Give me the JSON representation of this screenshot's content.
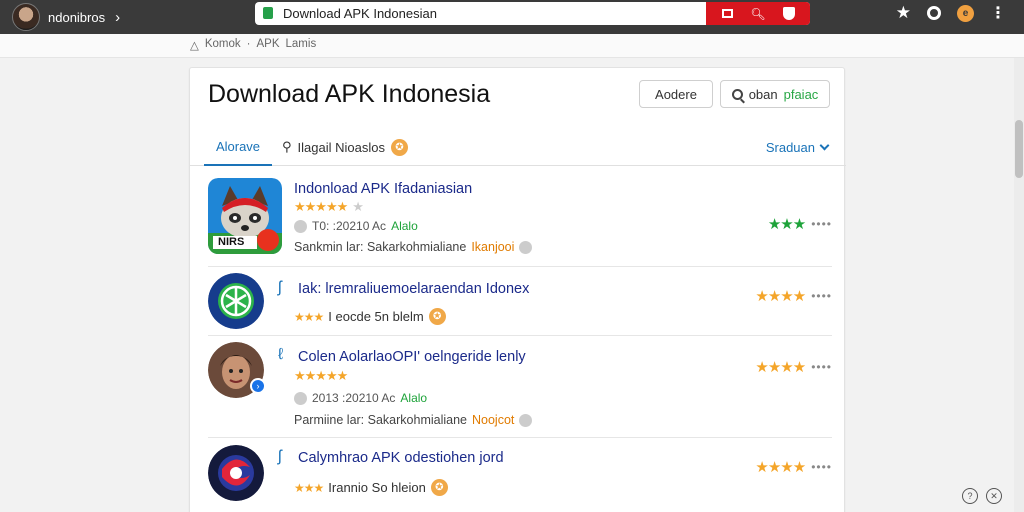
{
  "browser": {
    "profile_name": "ndonibros",
    "url": "Download APK Indonesian"
  },
  "breadcrumb": {
    "items": [
      "Komok",
      "APK",
      "Lamis"
    ],
    "separator": "·"
  },
  "header": {
    "title": "Download APK Indonesia",
    "button_1": "Aodere",
    "button_2_prefix": "oban",
    "button_2_green": "pfaiac"
  },
  "tabs": {
    "active": "Alorave",
    "search_label": "Ilagail Nioaslos",
    "sort_label": "Sraduan"
  },
  "items": [
    {
      "title": "Indonload APK Ifadaniasian",
      "stars": "★★★★★",
      "meta_prefix": "T0: :20210 Ac",
      "meta_green": "Alalo",
      "desc": "Sankmin lar: Sakarkohmialiane",
      "desc_orange": "Ikanjooi",
      "rating": "★★★",
      "icon_label": "NIRS"
    },
    {
      "title": "Iak: lremraliuemoelaraendan Idonex",
      "stars": "★★★",
      "desc": "I eocde 5n blelm",
      "rating": "★★★★"
    },
    {
      "title": "Colen AolarlaoOPI' oelngeride lenly",
      "stars": "★★★★★",
      "meta_prefix": "2013 :20210 Ac",
      "meta_green": "Alalo",
      "desc": "Parmiine lar: Sakarkohmialiane",
      "desc_orange": "Noojcot",
      "rating": "★★★★"
    },
    {
      "title": "Calymhrao APK odestiohen jord",
      "stars": "★★★",
      "desc": "Irannio So hleion",
      "rating": "★★★★"
    }
  ],
  "colors": {
    "accent": "#1a73b8",
    "star": "#f4a52a",
    "green": "#1ea33a",
    "urlbar_red": "#d8161e"
  }
}
